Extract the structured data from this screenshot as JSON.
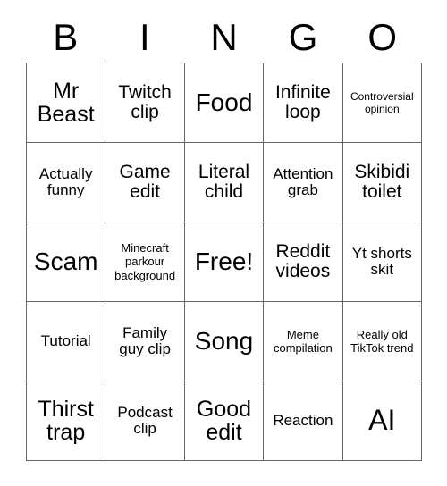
{
  "card": {
    "title": "BINGO",
    "header_letters": [
      "B",
      "I",
      "N",
      "G",
      "O"
    ],
    "colors": {
      "background": "#ffffff",
      "text": "#000000",
      "grid_line": "#666666"
    },
    "rows": [
      [
        {
          "text": "Mr Beast",
          "size": "lg"
        },
        {
          "text": "Twitch clip",
          "size": "md"
        },
        {
          "text": "Food",
          "size": "xl"
        },
        {
          "text": "Infinite loop",
          "size": "md"
        },
        {
          "text": "Controversial opinion",
          "size": "xxs"
        }
      ],
      [
        {
          "text": "Actually funny",
          "size": "sm"
        },
        {
          "text": "Game edit",
          "size": "md"
        },
        {
          "text": "Literal child",
          "size": "md"
        },
        {
          "text": "Attention grab",
          "size": "sm"
        },
        {
          "text": "Skibidi toilet",
          "size": "md"
        }
      ],
      [
        {
          "text": "Scam",
          "size": "xl"
        },
        {
          "text": "Minecraft parkour background",
          "size": "xs"
        },
        {
          "text": "Free!",
          "size": "xl"
        },
        {
          "text": "Reddit videos",
          "size": "md"
        },
        {
          "text": "Yt shorts skit",
          "size": "sm"
        }
      ],
      [
        {
          "text": "Tutorial",
          "size": "sm"
        },
        {
          "text": "Family guy clip",
          "size": "sm"
        },
        {
          "text": "Song",
          "size": "xl"
        },
        {
          "text": "Meme compilation",
          "size": "xs"
        },
        {
          "text": "Really old TikTok trend",
          "size": "xs"
        }
      ],
      [
        {
          "text": "Thirst trap",
          "size": "lg"
        },
        {
          "text": "Podcast clip",
          "size": "sm"
        },
        {
          "text": "Good edit",
          "size": "lg"
        },
        {
          "text": "Reaction",
          "size": "sm"
        },
        {
          "text": "AI",
          "size": "xxl"
        }
      ]
    ]
  }
}
